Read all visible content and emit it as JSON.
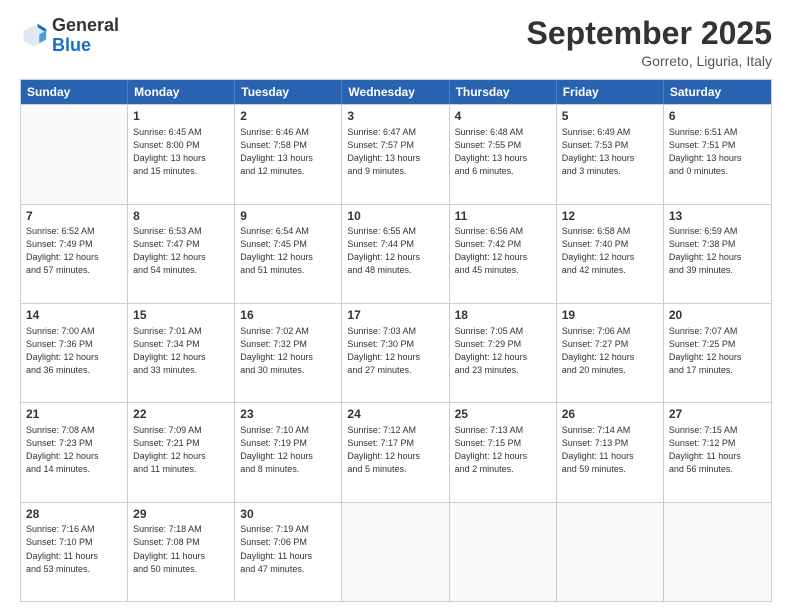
{
  "logo": {
    "general": "General",
    "blue": "Blue"
  },
  "header": {
    "title": "September 2025",
    "location": "Gorreto, Liguria, Italy"
  },
  "weekdays": [
    "Sunday",
    "Monday",
    "Tuesday",
    "Wednesday",
    "Thursday",
    "Friday",
    "Saturday"
  ],
  "weeks": [
    [
      {
        "day": "",
        "text": ""
      },
      {
        "day": "1",
        "text": "Sunrise: 6:45 AM\nSunset: 8:00 PM\nDaylight: 13 hours\nand 15 minutes."
      },
      {
        "day": "2",
        "text": "Sunrise: 6:46 AM\nSunset: 7:58 PM\nDaylight: 13 hours\nand 12 minutes."
      },
      {
        "day": "3",
        "text": "Sunrise: 6:47 AM\nSunset: 7:57 PM\nDaylight: 13 hours\nand 9 minutes."
      },
      {
        "day": "4",
        "text": "Sunrise: 6:48 AM\nSunset: 7:55 PM\nDaylight: 13 hours\nand 6 minutes."
      },
      {
        "day": "5",
        "text": "Sunrise: 6:49 AM\nSunset: 7:53 PM\nDaylight: 13 hours\nand 3 minutes."
      },
      {
        "day": "6",
        "text": "Sunrise: 6:51 AM\nSunset: 7:51 PM\nDaylight: 13 hours\nand 0 minutes."
      }
    ],
    [
      {
        "day": "7",
        "text": "Sunrise: 6:52 AM\nSunset: 7:49 PM\nDaylight: 12 hours\nand 57 minutes."
      },
      {
        "day": "8",
        "text": "Sunrise: 6:53 AM\nSunset: 7:47 PM\nDaylight: 12 hours\nand 54 minutes."
      },
      {
        "day": "9",
        "text": "Sunrise: 6:54 AM\nSunset: 7:45 PM\nDaylight: 12 hours\nand 51 minutes."
      },
      {
        "day": "10",
        "text": "Sunrise: 6:55 AM\nSunset: 7:44 PM\nDaylight: 12 hours\nand 48 minutes."
      },
      {
        "day": "11",
        "text": "Sunrise: 6:56 AM\nSunset: 7:42 PM\nDaylight: 12 hours\nand 45 minutes."
      },
      {
        "day": "12",
        "text": "Sunrise: 6:58 AM\nSunset: 7:40 PM\nDaylight: 12 hours\nand 42 minutes."
      },
      {
        "day": "13",
        "text": "Sunrise: 6:59 AM\nSunset: 7:38 PM\nDaylight: 12 hours\nand 39 minutes."
      }
    ],
    [
      {
        "day": "14",
        "text": "Sunrise: 7:00 AM\nSunset: 7:36 PM\nDaylight: 12 hours\nand 36 minutes."
      },
      {
        "day": "15",
        "text": "Sunrise: 7:01 AM\nSunset: 7:34 PM\nDaylight: 12 hours\nand 33 minutes."
      },
      {
        "day": "16",
        "text": "Sunrise: 7:02 AM\nSunset: 7:32 PM\nDaylight: 12 hours\nand 30 minutes."
      },
      {
        "day": "17",
        "text": "Sunrise: 7:03 AM\nSunset: 7:30 PM\nDaylight: 12 hours\nand 27 minutes."
      },
      {
        "day": "18",
        "text": "Sunrise: 7:05 AM\nSunset: 7:29 PM\nDaylight: 12 hours\nand 23 minutes."
      },
      {
        "day": "19",
        "text": "Sunrise: 7:06 AM\nSunset: 7:27 PM\nDaylight: 12 hours\nand 20 minutes."
      },
      {
        "day": "20",
        "text": "Sunrise: 7:07 AM\nSunset: 7:25 PM\nDaylight: 12 hours\nand 17 minutes."
      }
    ],
    [
      {
        "day": "21",
        "text": "Sunrise: 7:08 AM\nSunset: 7:23 PM\nDaylight: 12 hours\nand 14 minutes."
      },
      {
        "day": "22",
        "text": "Sunrise: 7:09 AM\nSunset: 7:21 PM\nDaylight: 12 hours\nand 11 minutes."
      },
      {
        "day": "23",
        "text": "Sunrise: 7:10 AM\nSunset: 7:19 PM\nDaylight: 12 hours\nand 8 minutes."
      },
      {
        "day": "24",
        "text": "Sunrise: 7:12 AM\nSunset: 7:17 PM\nDaylight: 12 hours\nand 5 minutes."
      },
      {
        "day": "25",
        "text": "Sunrise: 7:13 AM\nSunset: 7:15 PM\nDaylight: 12 hours\nand 2 minutes."
      },
      {
        "day": "26",
        "text": "Sunrise: 7:14 AM\nSunset: 7:13 PM\nDaylight: 11 hours\nand 59 minutes."
      },
      {
        "day": "27",
        "text": "Sunrise: 7:15 AM\nSunset: 7:12 PM\nDaylight: 11 hours\nand 56 minutes."
      }
    ],
    [
      {
        "day": "28",
        "text": "Sunrise: 7:16 AM\nSunset: 7:10 PM\nDaylight: 11 hours\nand 53 minutes."
      },
      {
        "day": "29",
        "text": "Sunrise: 7:18 AM\nSunset: 7:08 PM\nDaylight: 11 hours\nand 50 minutes."
      },
      {
        "day": "30",
        "text": "Sunrise: 7:19 AM\nSunset: 7:06 PM\nDaylight: 11 hours\nand 47 minutes."
      },
      {
        "day": "",
        "text": ""
      },
      {
        "day": "",
        "text": ""
      },
      {
        "day": "",
        "text": ""
      },
      {
        "day": "",
        "text": ""
      }
    ]
  ]
}
